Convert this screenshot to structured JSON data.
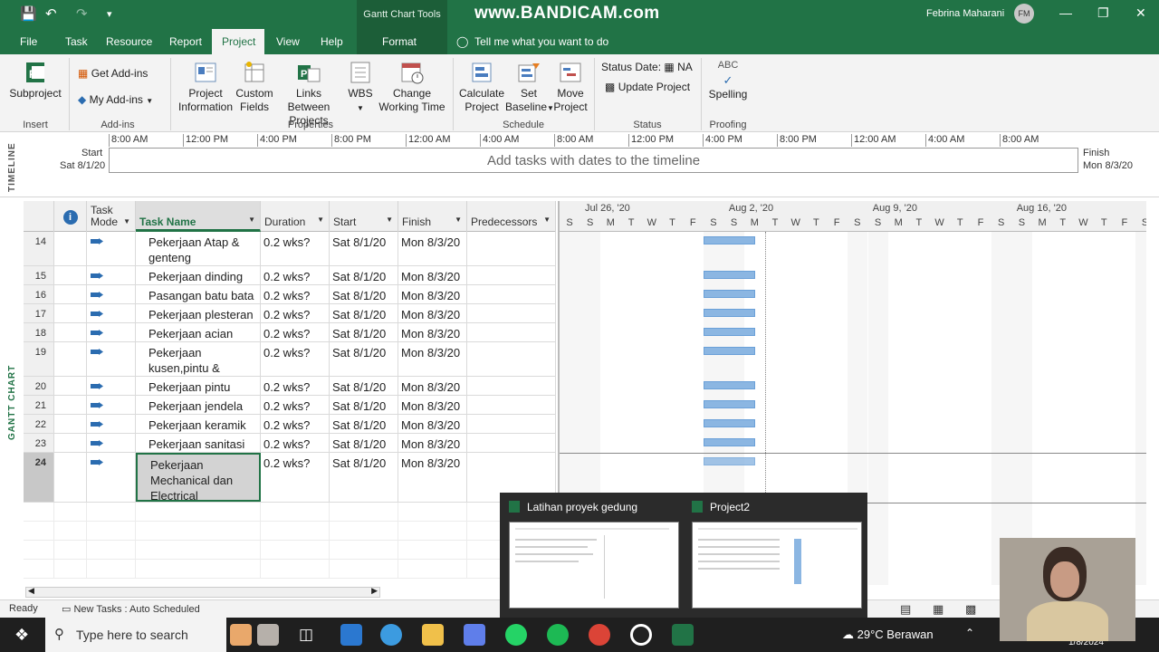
{
  "window": {
    "context_tab_group": "Gantt Chart Tools",
    "watermark": "www.BANDICAM.com",
    "user_name": "Febrina Maharani",
    "user_initials": "FM"
  },
  "ribbon_tabs": [
    "File",
    "Task",
    "Resource",
    "Report",
    "Project",
    "View",
    "Help",
    "Format"
  ],
  "tell_me": "Tell me what you want to do",
  "ribbon": {
    "subproject": "Subproject",
    "insert_group": "Insert",
    "get_addins": "Get Add-ins",
    "my_addins": "My Add-ins",
    "addins_group": "Add-ins",
    "project_information": [
      "Project",
      "Information"
    ],
    "custom_fields": [
      "Custom",
      "Fields"
    ],
    "links_between_projects": [
      "Links Between",
      "Projects"
    ],
    "wbs": "WBS",
    "change_working_time": [
      "Change",
      "Working Time"
    ],
    "properties_group": "Properties",
    "calculate_project": [
      "Calculate",
      "Project"
    ],
    "set_baseline": [
      "Set",
      "Baseline"
    ],
    "move_project": [
      "Move",
      "Project"
    ],
    "schedule_group": "Schedule",
    "status_date_label": "Status Date:",
    "status_date_value": "NA",
    "update_project": "Update Project",
    "status_group": "Status",
    "spelling_abc": "ABC",
    "spelling": "Spelling",
    "proofing_group": "Proofing"
  },
  "timeline": {
    "side_label": "TIMELINE",
    "start_label": "Start",
    "start_date": "Sat 8/1/20",
    "finish_label": "Finish",
    "finish_date": "Mon 8/3/20",
    "ticks": [
      "8:00 AM",
      "12:00 PM",
      "4:00 PM",
      "8:00 PM",
      "12:00 AM",
      "4:00 AM",
      "8:00 AM",
      "12:00 PM",
      "4:00 PM",
      "8:00 PM",
      "12:00 AM",
      "4:00 AM",
      "8:00 AM"
    ],
    "placeholder": "Add tasks with dates to the timeline"
  },
  "gantt_side_label": "GANTT CHART",
  "sheet": {
    "headers": {
      "info": "i",
      "mode": [
        "Task",
        "Mode"
      ],
      "name": "Task Name",
      "duration": "Duration",
      "start": "Start",
      "finish": "Finish",
      "predecessors": "Predecessors"
    },
    "rows": [
      {
        "id": "14",
        "name": [
          "Pekerjaan Atap &",
          "genteng"
        ],
        "duration": "0.2 wks?",
        "start": "Sat 8/1/20",
        "finish": "Mon 8/3/20"
      },
      {
        "id": "15",
        "name": [
          "Pekerjaan dinding"
        ],
        "duration": "0.2 wks?",
        "start": "Sat 8/1/20",
        "finish": "Mon 8/3/20"
      },
      {
        "id": "16",
        "name": [
          "Pasangan batu bata"
        ],
        "duration": "0.2 wks?",
        "start": "Sat 8/1/20",
        "finish": "Mon 8/3/20"
      },
      {
        "id": "17",
        "name": [
          "Pekerjaan plesteran"
        ],
        "duration": "0.2 wks?",
        "start": "Sat 8/1/20",
        "finish": "Mon 8/3/20"
      },
      {
        "id": "18",
        "name": [
          "Pekerjaan acian"
        ],
        "duration": "0.2 wks?",
        "start": "Sat 8/1/20",
        "finish": "Mon 8/3/20"
      },
      {
        "id": "19",
        "name": [
          "Pekerjaan",
          "kusen,pintu &"
        ],
        "duration": "0.2 wks?",
        "start": "Sat 8/1/20",
        "finish": "Mon 8/3/20"
      },
      {
        "id": "20",
        "name": [
          "Pekerjaan pintu"
        ],
        "duration": "0.2 wks?",
        "start": "Sat 8/1/20",
        "finish": "Mon 8/3/20"
      },
      {
        "id": "21",
        "name": [
          "Pekerjaan jendela"
        ],
        "duration": "0.2 wks?",
        "start": "Sat 8/1/20",
        "finish": "Mon 8/3/20"
      },
      {
        "id": "22",
        "name": [
          "Pekerjaan keramik"
        ],
        "duration": "0.2 wks?",
        "start": "Sat 8/1/20",
        "finish": "Mon 8/3/20"
      },
      {
        "id": "23",
        "name": [
          "Pekerjaan sanitasi"
        ],
        "duration": "0.2 wks?",
        "start": "Sat 8/1/20",
        "finish": "Mon 8/3/20"
      },
      {
        "id": "24",
        "name": [
          "Pekerjaan",
          "Mechanical dan",
          "Electrical"
        ],
        "duration": "0.2 wks?",
        "start": "Sat 8/1/20",
        "finish": "Mon 8/3/20"
      }
    ]
  },
  "gantt": {
    "weeks": [
      "Jul 26, '20",
      "Aug 2, '20",
      "Aug 9, '20",
      "Aug 16, '20"
    ],
    "days": [
      "S",
      "S",
      "M",
      "T",
      "W",
      "T",
      "F",
      "S",
      "S",
      "M",
      "T",
      "W",
      "T",
      "F",
      "S",
      "S",
      "M",
      "T",
      "W",
      "T",
      "F",
      "S",
      "S",
      "M",
      "T",
      "W",
      "T",
      "F",
      "S"
    ],
    "bar_color": "#8bb6e2"
  },
  "status_bar": {
    "ready": "Ready",
    "new_tasks": "New Tasks : Auto Scheduled"
  },
  "taskbar": {
    "search_placeholder": "Type here to search",
    "weather": "29°C  Berawan",
    "date": "1/8/2024",
    "thumbnails": [
      "Latihan proyek gedung",
      "Project2"
    ]
  }
}
